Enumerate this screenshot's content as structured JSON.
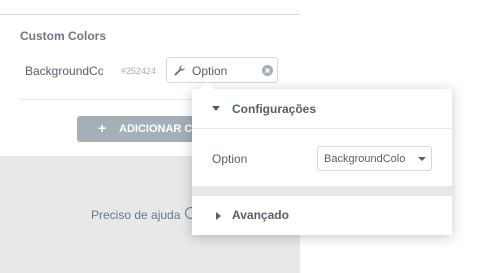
{
  "custom_colors": {
    "section_title": "Custom Colors",
    "row": {
      "name": "BackgroundCo",
      "hex": "#252424",
      "tag_label": "Option"
    },
    "add_button_label": "ADICIONAR CO",
    "add_button_icon": "plus-icon"
  },
  "help": {
    "text": "Preciso de ajuda"
  },
  "popover": {
    "settings_title": "Configurações",
    "option_label": "Option",
    "select_value": "BackgroundColo",
    "advanced_title": "Avançado"
  },
  "colors": {
    "panel_bg": "#e6e8ea",
    "button_gray": "#a4afb7",
    "text": "#556068"
  }
}
